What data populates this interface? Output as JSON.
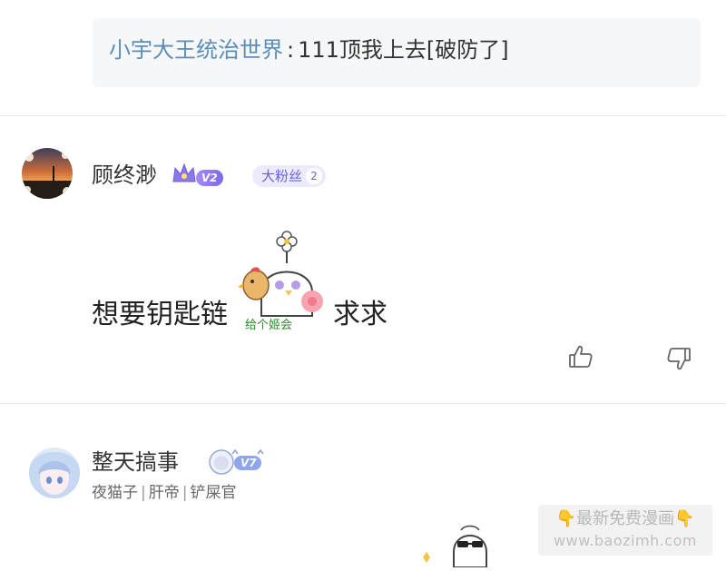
{
  "reply": {
    "user": "小宇大王统治世界",
    "separator": ":",
    "text": "111顶我上去[破防了]"
  },
  "comments": [
    {
      "username": "顾终渺",
      "level": "V2",
      "fan_badge": "大粉丝",
      "fan_level": "2",
      "text_before": "想要钥匙链",
      "sticker_text": "给个姬会",
      "text_after": "求求"
    },
    {
      "username": "整天搞事",
      "level": "V7",
      "tags": [
        "夜猫子",
        "肝帝",
        "铲屎官"
      ]
    }
  ],
  "watermark": {
    "title": "最新免费漫画",
    "url": "www.baozimh.com"
  },
  "colors": {
    "link_blue": "#5b8db8",
    "badge_purple": "#7f6ae6",
    "fan_bg": "#ecebfb",
    "divider": "#e8e8e8"
  },
  "icons": [
    "thumbs-up-icon",
    "thumbs-down-icon",
    "crown-icon"
  ]
}
